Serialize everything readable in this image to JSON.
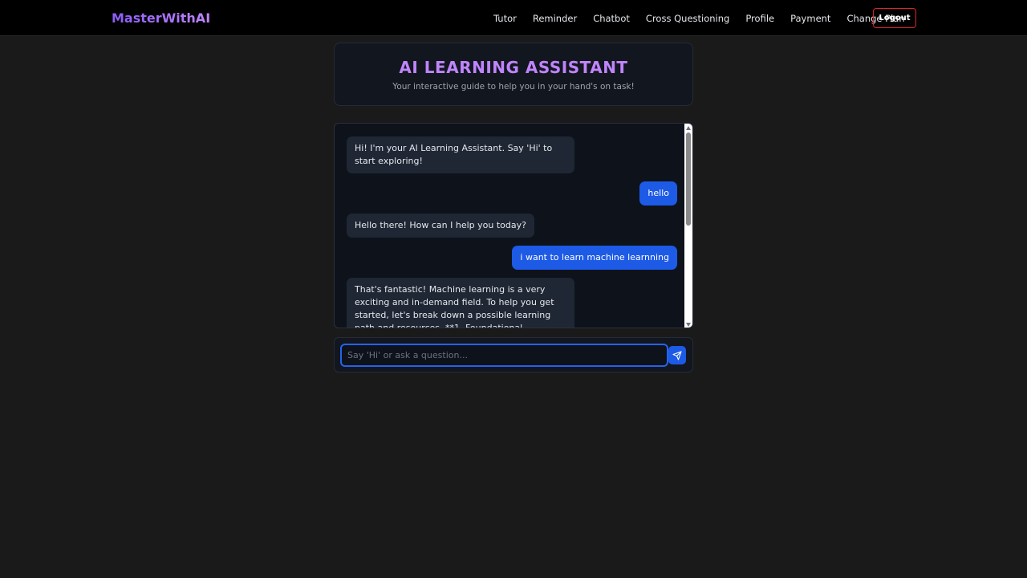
{
  "nav": {
    "brand": "MasterWithAI",
    "links": [
      "Tutor",
      "Reminder",
      "Chatbot",
      "Cross Questioning",
      "Profile",
      "Payment",
      "Change Plan"
    ],
    "logout_label": "Logout"
  },
  "header": {
    "title": "AI LEARNING ASSISTANT",
    "subtitle": "Your interactive guide to help you in your hand's on task!"
  },
  "chat": {
    "messages": [
      {
        "role": "bot",
        "text": "Hi! I'm your AI Learning Assistant. Say 'Hi' to start exploring!"
      },
      {
        "role": "user",
        "text": "hello"
      },
      {
        "role": "bot",
        "text": "Hello there! How can I help you today?"
      },
      {
        "role": "user",
        "text": "i want to learn machine learnning"
      },
      {
        "role": "bot",
        "text": "That's fantastic! Machine learning is a very exciting and in-demand field. To help you get started, let's break down a possible learning path and resources. **1. Foundational Knowledge (Essential):** * **Mathematics:** * **Linear Algebra:** Vectors, matrices, and operations on them."
      }
    ]
  },
  "input": {
    "placeholder": "Say 'Hi' or ask a question...",
    "value": ""
  },
  "icons": {
    "send": "send-icon"
  },
  "colors": {
    "accent": "#c084fc",
    "user_bubble": "#1d5ae6",
    "logout_border": "#dc2626"
  }
}
